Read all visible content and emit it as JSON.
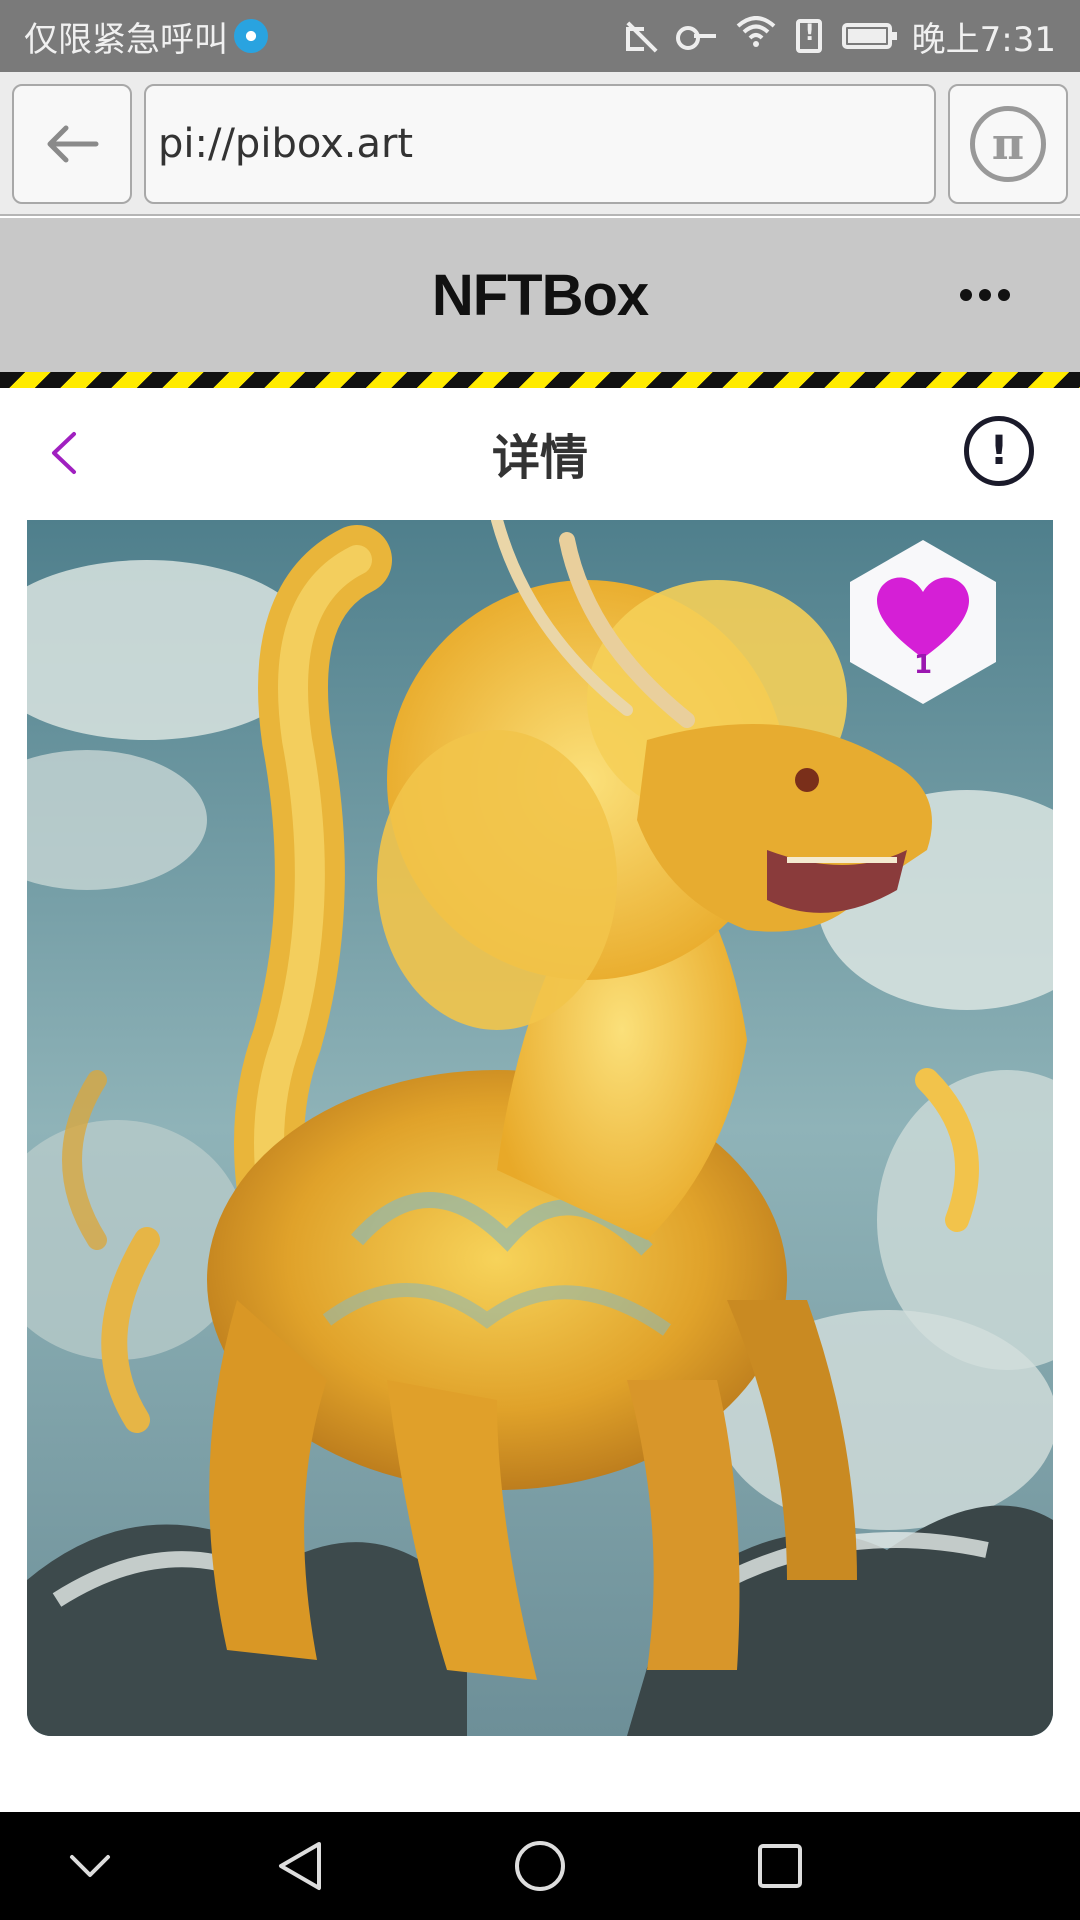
{
  "status_bar": {
    "carrier_text": "仅限紧急呼叫",
    "time": "晚上7:31",
    "icons": [
      "mute-icon",
      "key-icon",
      "wifi-icon",
      "sim-alert-icon",
      "battery-icon"
    ]
  },
  "browser": {
    "url": "pi://pibox.art",
    "back_icon": "arrow-left-icon",
    "pi_icon": "pi-logo-icon",
    "pi_symbol": "π"
  },
  "app_header": {
    "title": "NFTBox",
    "more_icon": "more-dots-icon"
  },
  "page_header": {
    "title": "详情",
    "back_icon": "chevron-left-icon",
    "info_symbol": "!"
  },
  "artwork": {
    "description_icon": "golden-qilin-image",
    "like_count": "1",
    "heart_color": "#d51fd6"
  },
  "nav_bar": {
    "icons": [
      "chevron-down-icon",
      "back-triangle-icon",
      "home-circle-icon",
      "recents-square-icon"
    ]
  },
  "colors": {
    "status_bar_bg": "#7a7a7a",
    "app_header_bg": "#c8c8c8",
    "hazard_yellow": "#ffeb00",
    "accent_purple": "#9b17b0"
  }
}
